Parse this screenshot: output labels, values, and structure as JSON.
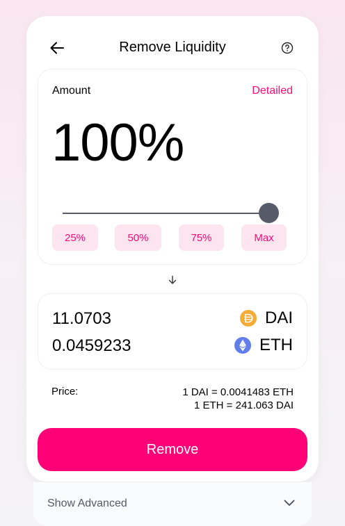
{
  "header": {
    "title": "Remove Liquidity",
    "back_icon": "arrow-left-icon",
    "help_icon": "question-circle-icon"
  },
  "amount": {
    "label": "Amount",
    "detailed_label": "Detailed",
    "percent_display": "100%",
    "slider_value": 100,
    "buttons": [
      "25%",
      "50%",
      "75%",
      "Max"
    ]
  },
  "outputs": [
    {
      "amount": "11.0703",
      "symbol": "DAI",
      "icon": "dai-token-icon",
      "color": "#F5AC37"
    },
    {
      "amount": "0.0459233",
      "symbol": "ETH",
      "icon": "eth-token-icon",
      "color": "#627EEA"
    }
  ],
  "price": {
    "label": "Price:",
    "rate1": "1 DAI = 0.0041483 ETH",
    "rate2": "1 ETH = 241.063 DAI"
  },
  "remove_label": "Remove",
  "advanced": {
    "label": "Show Advanced",
    "icon": "chevron-down-icon"
  },
  "colors": {
    "accent": "#FF007A",
    "accent_light": "#FDE5F0",
    "slider": "#565A69"
  }
}
